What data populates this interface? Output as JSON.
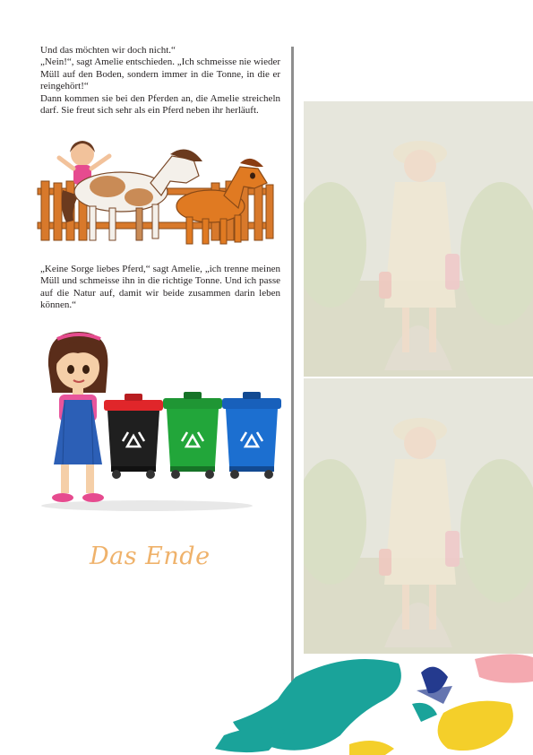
{
  "story": {
    "paragraph_1": [
      "Und das möchten wir doch nicht.“",
      "„Nein!“, sagt Amelie entschieden. „Ich schmeisse nie wieder Müll auf den Boden, sondern immer in die Tonne, in die er reingehört!“",
      "Dann kommen sie bei den Pferden an, die Amelie streicheln darf. Sie freut sich sehr als ein Pferd neben ihr herläuft."
    ],
    "paragraph_2": "„Keine Sorge liebes Pferd,“ sagt Amelie, „ich trenne meinen Müll und schmeisse ihn in die richtige Tonne. Und ich passe auf die Natur auf, damit wir beide zusammen darin leben können.“",
    "ending": "Das Ende"
  },
  "bins": [
    {
      "color": "#1f1f1f",
      "lid": "#e0262a",
      "name": "black-bin"
    },
    {
      "color": "#22a63a",
      "lid": "#22a63a",
      "name": "green-bin"
    },
    {
      "color": "#1c6fd0",
      "lid": "#1c6fd0",
      "name": "blue-bin"
    }
  ],
  "colors": {
    "accent": "#efb26b",
    "divider": "#8e8e8e",
    "paint_teal": "#1aa39a",
    "paint_yellow": "#f4cf2a",
    "paint_navy": "#243a8e",
    "paint_pink": "#f4a9b0"
  },
  "icons": [
    "recycle-icon"
  ]
}
